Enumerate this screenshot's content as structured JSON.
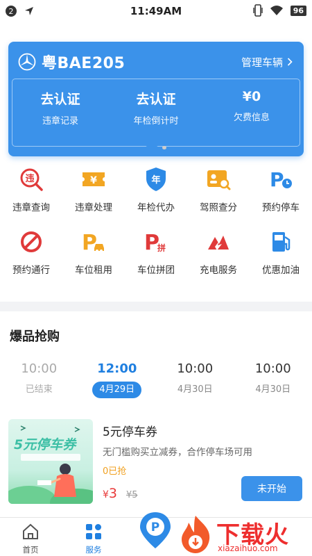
{
  "status_bar": {
    "notification_count": "2",
    "time": "11:49AM",
    "battery": "96"
  },
  "vehicle": {
    "plate": "粤BAE205",
    "manage_label": "管理车辆",
    "stats": [
      {
        "value": "去认证",
        "label": "违章记录"
      },
      {
        "value": "去认证",
        "label": "年检倒计时"
      },
      {
        "value": "¥0",
        "label": "欠费信息"
      }
    ]
  },
  "services": [
    {
      "label": "违章查询",
      "icon": "violation-search-icon"
    },
    {
      "label": "违章处理",
      "icon": "violation-handle-icon"
    },
    {
      "label": "年检代办",
      "icon": "annual-inspection-icon"
    },
    {
      "label": "驾照查分",
      "icon": "license-score-icon"
    },
    {
      "label": "预约停车",
      "icon": "reserve-parking-icon"
    },
    {
      "label": "预约通行",
      "icon": "reserve-pass-icon"
    },
    {
      "label": "车位租用",
      "icon": "space-rent-icon"
    },
    {
      "label": "车位拼团",
      "icon": "space-group-icon"
    },
    {
      "label": "充电服务",
      "icon": "charging-icon"
    },
    {
      "label": "优惠加油",
      "icon": "fuel-icon"
    }
  ],
  "flash_sale": {
    "title": "爆品抢购",
    "slots": [
      {
        "time": "10:00",
        "sub": "已结束"
      },
      {
        "time": "12:00",
        "sub": "4月29日"
      },
      {
        "time": "10:00",
        "sub": "4月30日"
      },
      {
        "time": "10:00",
        "sub": "4月30日"
      }
    ],
    "product": {
      "image_text": "5元停车券",
      "name": "5元停车券",
      "desc": "无门槛购买立减券，合作停车场可用",
      "sold": "0已抢",
      "currency": "¥",
      "price": "3",
      "old_price": "¥5",
      "button": "未开始"
    }
  },
  "bottom_nav": {
    "home": "首页",
    "service": "服务"
  },
  "watermark": {
    "text": "下载火",
    "sub": "xiazaihuo.com"
  },
  "colors": {
    "primary": "#3b92ea",
    "price_red": "#e93a3a",
    "sold_orange": "#f0a020"
  }
}
